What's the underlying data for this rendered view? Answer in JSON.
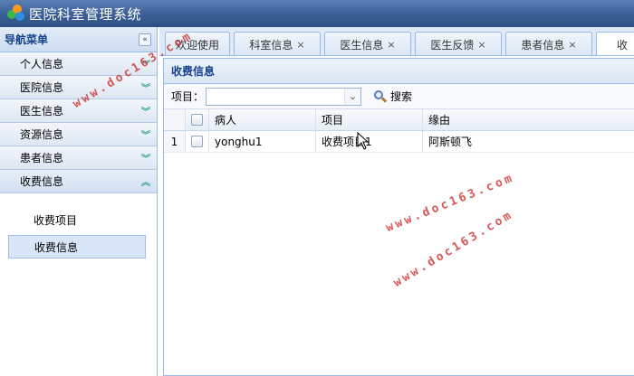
{
  "app": {
    "title": "医院科室管理系统"
  },
  "nav": {
    "title": "导航菜单",
    "collapse_icon": "«",
    "items": [
      {
        "label": "个人信息",
        "icon": "chevrons-down-icon",
        "open": false
      },
      {
        "label": "医院信息",
        "icon": "chevrons-down-icon",
        "open": false
      },
      {
        "label": "医生信息",
        "icon": "chevrons-down-icon",
        "open": false
      },
      {
        "label": "资源信息",
        "icon": "chevrons-down-icon",
        "open": false
      },
      {
        "label": "患者信息",
        "icon": "chevrons-down-icon",
        "open": false
      },
      {
        "label": "收费信息",
        "icon": "chevrons-up-icon",
        "open": true
      }
    ],
    "submenu": [
      {
        "label": "收费项目",
        "active": false
      },
      {
        "label": "收费信息",
        "active": true
      }
    ]
  },
  "tabs": [
    {
      "label": "欢迎使用",
      "closable": false,
      "active": false
    },
    {
      "label": "科室信息",
      "closable": true,
      "active": false
    },
    {
      "label": "医生信息",
      "closable": true,
      "active": false
    },
    {
      "label": "医生反馈",
      "closable": true,
      "active": false
    },
    {
      "label": "患者信息",
      "closable": true,
      "active": false
    },
    {
      "label": "收",
      "closable": false,
      "active": true
    }
  ],
  "tab_close_symbol": "×",
  "panel": {
    "title": "收费信息",
    "filter": {
      "label": "项目：",
      "value": "",
      "placeholder": ""
    },
    "search_label": "搜索",
    "columns": [
      "病人",
      "项目",
      "缘由"
    ],
    "rows": [
      {
        "num": "1",
        "patient": "yonghu1",
        "project": "收费项目1",
        "reason": "阿斯顿飞"
      }
    ]
  },
  "watermark": "www.doc163.com",
  "colors": {
    "titlebar": "#3a5e94",
    "accent": "#15428b",
    "border": "#99bbe8",
    "watermark": "#cd2d2d"
  }
}
